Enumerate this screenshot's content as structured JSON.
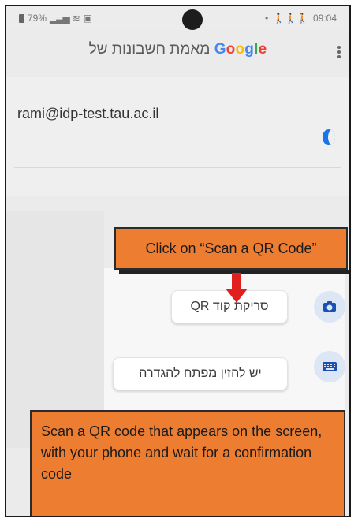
{
  "status": {
    "battery": "79%",
    "time": "09:04"
  },
  "app": {
    "title_prefix": "מאמת חשבונות של",
    "brand": "Google",
    "menu_icon": "kebab-icon"
  },
  "account": {
    "email": "rami@idp-test.tau.ac.il",
    "status_icon": "crescent-icon"
  },
  "fab_menu": {
    "scan_label": "סריקת קוד QR",
    "scan_icon": "camera-icon",
    "key_label": "יש להזין מפתח להגדרה",
    "key_icon": "keyboard-icon"
  },
  "annotations": {
    "top_callout": "Click on “Scan a QR Code”",
    "bottom_callout": "Scan a QR code that appears on the screen, with your phone and wait for a confirmation code"
  },
  "colors": {
    "callout": "#ed7d31",
    "arrow": "#e02020",
    "google_blue": "#4285F4",
    "google_red": "#EA4335",
    "google_yellow": "#FBBC05",
    "google_green": "#34A853"
  }
}
